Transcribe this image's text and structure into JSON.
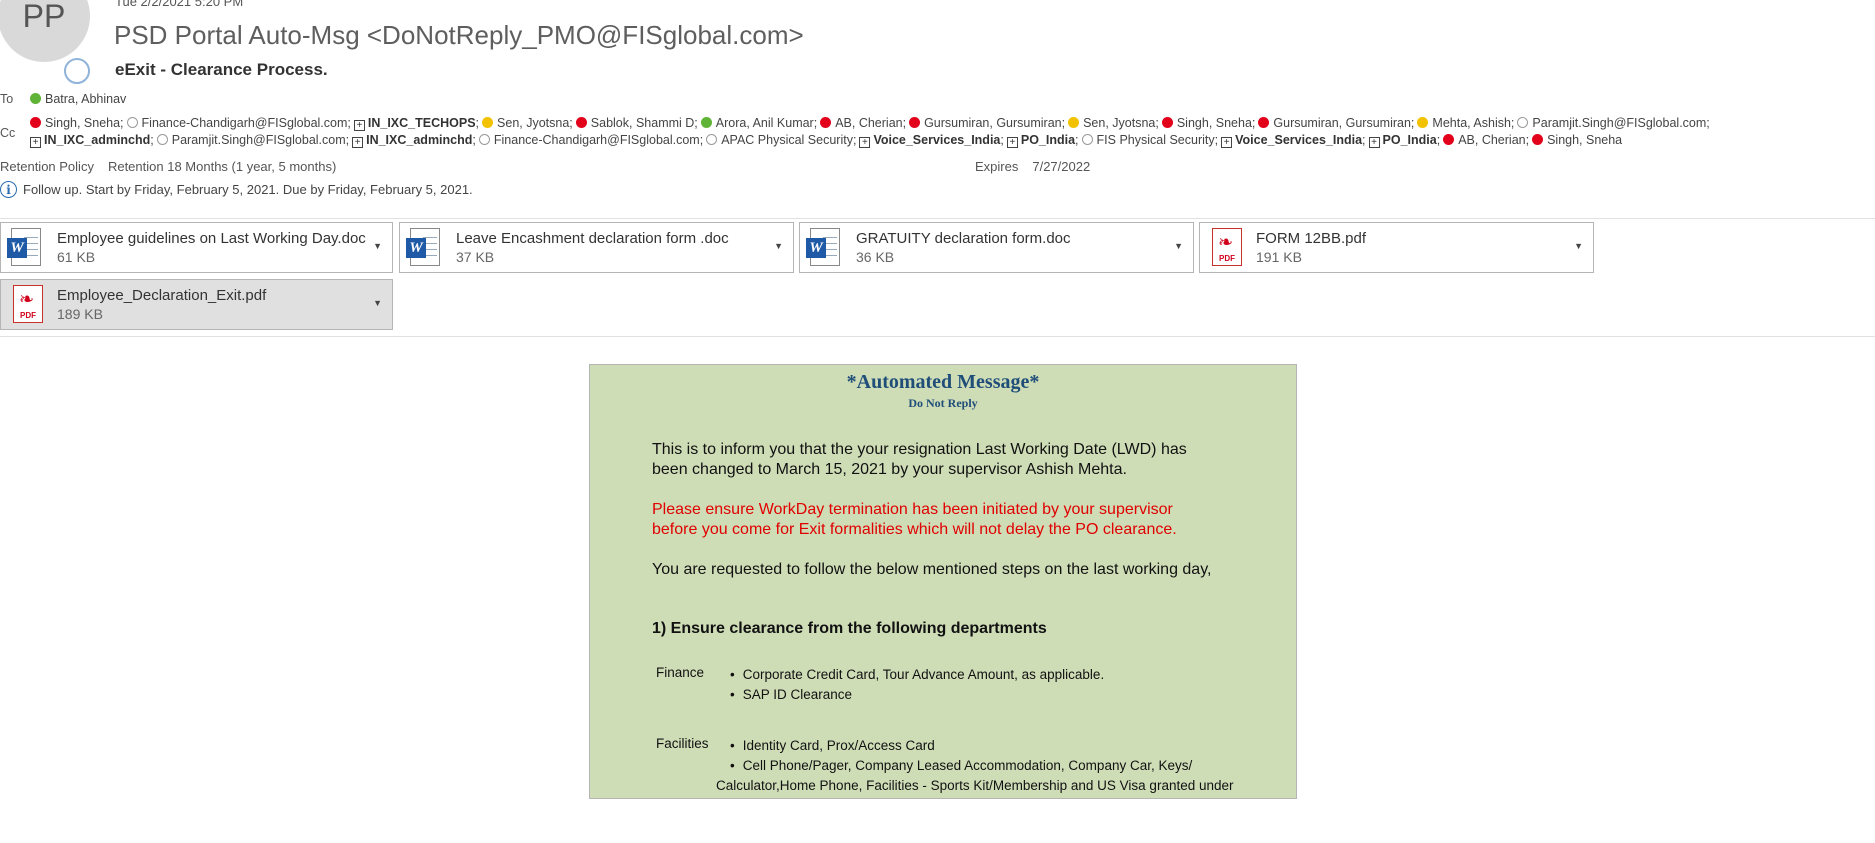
{
  "header": {
    "avatar_initials": "PP",
    "sent": "Tue 2/2/2021 5:20 PM",
    "from": "PSD Portal Auto-Msg <DoNotReply_PMO@FISglobal.com>",
    "subject": "eExit - Clearance Process."
  },
  "to": {
    "label": "To",
    "recipient": "Batra, Abhinav"
  },
  "cc": {
    "label": "Cc",
    "line1": [
      {
        "status": "red",
        "name": "Singh, Sneha;"
      },
      {
        "status": "empty",
        "name": "Finance-Chandigarh@FISglobal.com;"
      },
      {
        "status": "group",
        "name": "IN_IXC_TECHOPS",
        "bold": true,
        "suffix": ";"
      },
      {
        "status": "yellow",
        "name": "Sen, Jyotsna;"
      },
      {
        "status": "red",
        "name": "Sablok, Shammi D;"
      },
      {
        "status": "green",
        "name": "Arora, Anil Kumar;"
      },
      {
        "status": "red",
        "name": "AB, Cherian;"
      },
      {
        "status": "red",
        "name": "Gursumiran, Gursumiran;"
      },
      {
        "status": "yellow",
        "name": "Sen, Jyotsna;"
      },
      {
        "status": "red",
        "name": "Singh, Sneha;"
      },
      {
        "status": "red",
        "name": "Gursumiran, Gursumiran;"
      },
      {
        "status": "yellow",
        "name": "Mehta, Ashish;"
      },
      {
        "status": "empty",
        "name": "Paramjit.Singh@FISglobal.com;"
      }
    ],
    "line2": [
      {
        "status": "group",
        "name": "IN_IXC_adminchd",
        "bold": true,
        "suffix": ";"
      },
      {
        "status": "empty",
        "name": "Paramjit.Singh@FISglobal.com;"
      },
      {
        "status": "group",
        "name": "IN_IXC_adminchd",
        "bold": true,
        "suffix": ";"
      },
      {
        "status": "empty",
        "name": "Finance-Chandigarh@FISglobal.com;"
      },
      {
        "status": "empty",
        "name": "APAC Physical Security;"
      },
      {
        "status": "group",
        "name": "Voice_Services_India",
        "bold": true,
        "suffix": ";"
      },
      {
        "status": "group",
        "name": "PO_India",
        "bold": true,
        "suffix": ";"
      },
      {
        "status": "empty",
        "name": "FIS Physical Security;"
      },
      {
        "status": "group",
        "name": "Voice_Services_India",
        "bold": true,
        "suffix": ";"
      },
      {
        "status": "group",
        "name": "PO_India",
        "bold": true,
        "suffix": ";"
      },
      {
        "status": "red",
        "name": "AB, Cherian;"
      },
      {
        "status": "red",
        "name": "Singh, Sneha"
      }
    ]
  },
  "retention": {
    "label": "Retention Policy",
    "value": "Retention 18 Months (1 year, 5 months)"
  },
  "expires": {
    "label": "Expires",
    "value": "7/27/2022"
  },
  "followup": "Follow up.  Start by Friday, February 5, 2021.  Due by Friday, February 5, 2021.",
  "attachments": [
    {
      "type": "doc",
      "name": "Employee guidelines on Last Working Day.doc",
      "size": "61 KB"
    },
    {
      "type": "doc",
      "name": "Leave Encashment declaration form .doc",
      "size": "37 KB"
    },
    {
      "type": "doc",
      "name": "GRATUITY declaration form.doc",
      "size": "36 KB"
    },
    {
      "type": "pdf",
      "name": "FORM 12BB.pdf",
      "size": "191 KB"
    },
    {
      "type": "pdf",
      "name": "Employee_Declaration_Exit.pdf",
      "size": "189 KB"
    }
  ],
  "pdf_tag": "PDF",
  "message": {
    "title": "*Automated Message*",
    "subtitle": "Do Not Reply",
    "para1": "This is to inform you that the your resignation Last Working Date (LWD) has been changed to March 15, 2021 by your supervisor Ashish Mehta.",
    "para2": "Please ensure WorkDay termination has been initiated by your supervisor before you come for Exit formalities which will not delay the PO clearance.",
    "para3": "You are requested to follow the below mentioned steps on the last working day,",
    "step1": "1) Ensure clearance from the following departments",
    "finance_label": "Finance",
    "finance_items": [
      "Corporate Credit Card, Tour Advance Amount, as applicable.",
      "SAP ID Clearance"
    ],
    "facilities_label": "Facilities",
    "facilities_item1": "Identity Card, Prox/Access Card",
    "facilities_item2a": "Cell Phone/Pager, Company Leased Accommodation, Company Car, Keys/",
    "facilities_item2b": "Calculator,Home Phone, Facilities - Sports Kit/Membership and US Visa granted under"
  }
}
